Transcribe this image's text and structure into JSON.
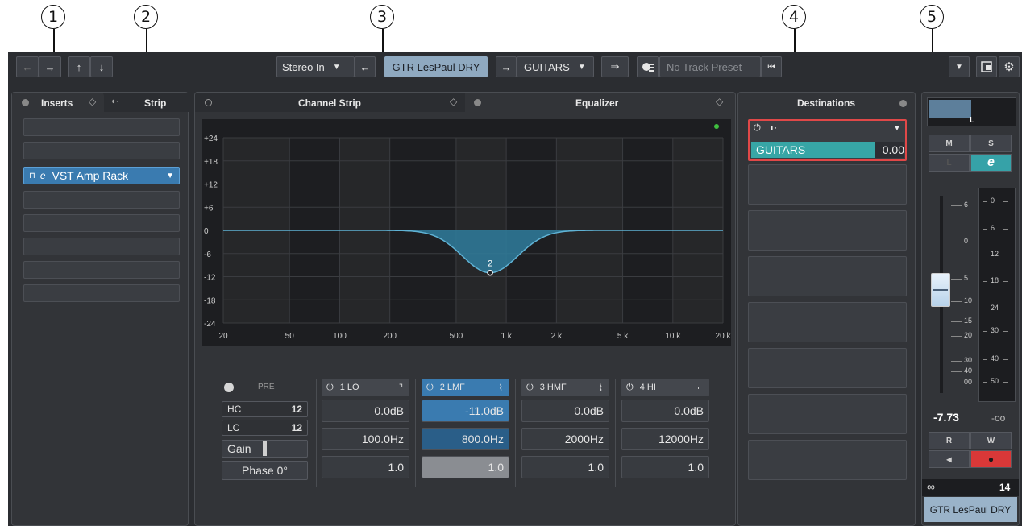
{
  "callouts": [
    "1",
    "2",
    "3",
    "4",
    "5"
  ],
  "toolbar": {
    "back": "←",
    "forward": "→",
    "up": "↑",
    "down": "↓",
    "input_routing": "Stereo In",
    "input_arrow": "▼",
    "left_arrow": "←",
    "track_name": "GTR LesPaul DRY",
    "right_arrow": "→",
    "output_routing": "GUITARS",
    "output_arrow": "▼",
    "send_icon": "⇒",
    "track_preset_placeholder": "No Track Preset",
    "rewind": "⏮",
    "dropdown": "▼",
    "settings": "⚙"
  },
  "inserts": {
    "tab_inserts": "Inserts",
    "tab_strip": "Strip",
    "plugin": "VST Amp Rack"
  },
  "channel_strip": {
    "tab_label": "Channel Strip",
    "eq_tab_label": "Equalizer"
  },
  "chart_data": {
    "type": "line",
    "x_ticks": [
      "20",
      "50",
      "100",
      "200",
      "500",
      "1 k",
      "2 k",
      "5 k",
      "10 k",
      "20 k"
    ],
    "y_ticks": [
      "+24",
      "+18",
      "+12",
      "+6",
      "0",
      "-6",
      "-12",
      "-18",
      "-24"
    ],
    "ylim": [
      -24,
      24
    ],
    "xlim": [
      20,
      20000
    ],
    "x_scale": "log",
    "bands": [
      {
        "label": "2",
        "freq": 800,
        "gain": -11.0
      }
    ]
  },
  "eq": {
    "pre": "PRE",
    "hc": "HC",
    "lc": "LC",
    "slope_icon": "12",
    "gain": "Gain",
    "phase": "Phase 0°",
    "bands": [
      {
        "name": "1 LO",
        "gain": "0.0dB",
        "freq": "100.0Hz",
        "q": "1.0",
        "shape": "⌝"
      },
      {
        "name": "2 LMF",
        "gain": "-11.0dB",
        "freq": "800.0Hz",
        "q": "1.0",
        "shape": "⌇"
      },
      {
        "name": "3 HMF",
        "gain": "0.0dB",
        "freq": "2000Hz",
        "q": "1.0",
        "shape": "⌇"
      },
      {
        "name": "4 HI",
        "gain": "0.0dB",
        "freq": "12000Hz",
        "q": "1.0",
        "shape": "⌐"
      }
    ]
  },
  "destinations": {
    "title": "Destinations",
    "dest_name": "GUITARS",
    "dest_value": "0.00",
    "menu": "▼"
  },
  "channel": {
    "pan": "L",
    "mute": "M",
    "solo": "S",
    "listen": "L",
    "edit": "e",
    "fader_scale": [
      "6",
      "0",
      "5",
      "10",
      "15",
      "20",
      "30",
      "40",
      "00"
    ],
    "meter_scale": [
      "0",
      "6",
      "12",
      "18",
      "24",
      "30",
      "40",
      "50"
    ],
    "volume": "-7.73",
    "peak": "-oo",
    "read": "R",
    "write": "W",
    "monitor": "◂",
    "record": "●",
    "link_icon": "∞",
    "channel_number": "14",
    "name": "GTR LesPaul DRY"
  }
}
